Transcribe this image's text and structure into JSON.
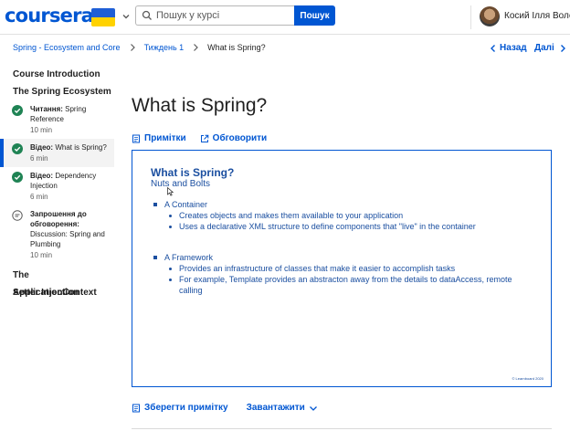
{
  "header": {
    "logo": "coursera",
    "search_placeholder": "Пошук у курсі",
    "search_button": "Пошук",
    "username": "Косий Ілля Воло..."
  },
  "breadcrumb": {
    "items": [
      "Spring - Ecosystem and Core",
      "Тиждень 1",
      "What is Spring?"
    ],
    "back_label": "Назад",
    "next_label": "Далі"
  },
  "sidebar": {
    "sections": [
      "Course Introduction",
      "The Spring Ecosystem",
      "The ApplicationContext",
      "Setter Injection"
    ],
    "items": [
      {
        "type": "Читання:",
        "title": "Spring Reference",
        "meta": "10 min",
        "icon": "check-circle-icon"
      },
      {
        "type": "Відео:",
        "title": "What is Spring?",
        "meta": "6 min",
        "icon": "check-circle-icon",
        "active": true
      },
      {
        "type": "Відео:",
        "title": "Dependency Injection",
        "meta": "6 min",
        "icon": "check-circle-icon"
      },
      {
        "type": "Запрошення до обговорення:",
        "title": "Discussion: Spring and Plumbing",
        "meta": "10 min",
        "icon": "discussion-icon"
      }
    ]
  },
  "main": {
    "title": "What is Spring?",
    "tabs": [
      "Примітки",
      "Обговорити"
    ],
    "actions": {
      "save_note": "Зберегти примітку",
      "download": "Завантажити"
    }
  },
  "slide": {
    "title": "What is Spring?",
    "subtitle": "Nuts and Bolts",
    "bullets": [
      {
        "text": "A Container",
        "sub": [
          "Creates objects and makes them available to your application",
          "Uses a declarative XML structure to define components that \"live\" in the container"
        ]
      },
      {
        "text": "A Framework",
        "sub": [
          "Provides an infrastructure of classes that make it easier to accomplish tasks",
          "For example, Template provides an abstracton away from the details to dataAccess, remote calling"
        ]
      }
    ],
    "copyright": "© Learnboard 2020"
  },
  "colors": {
    "brand": "#0056d2",
    "slide_text": "#1b4fa0",
    "success": "#1f8354"
  }
}
